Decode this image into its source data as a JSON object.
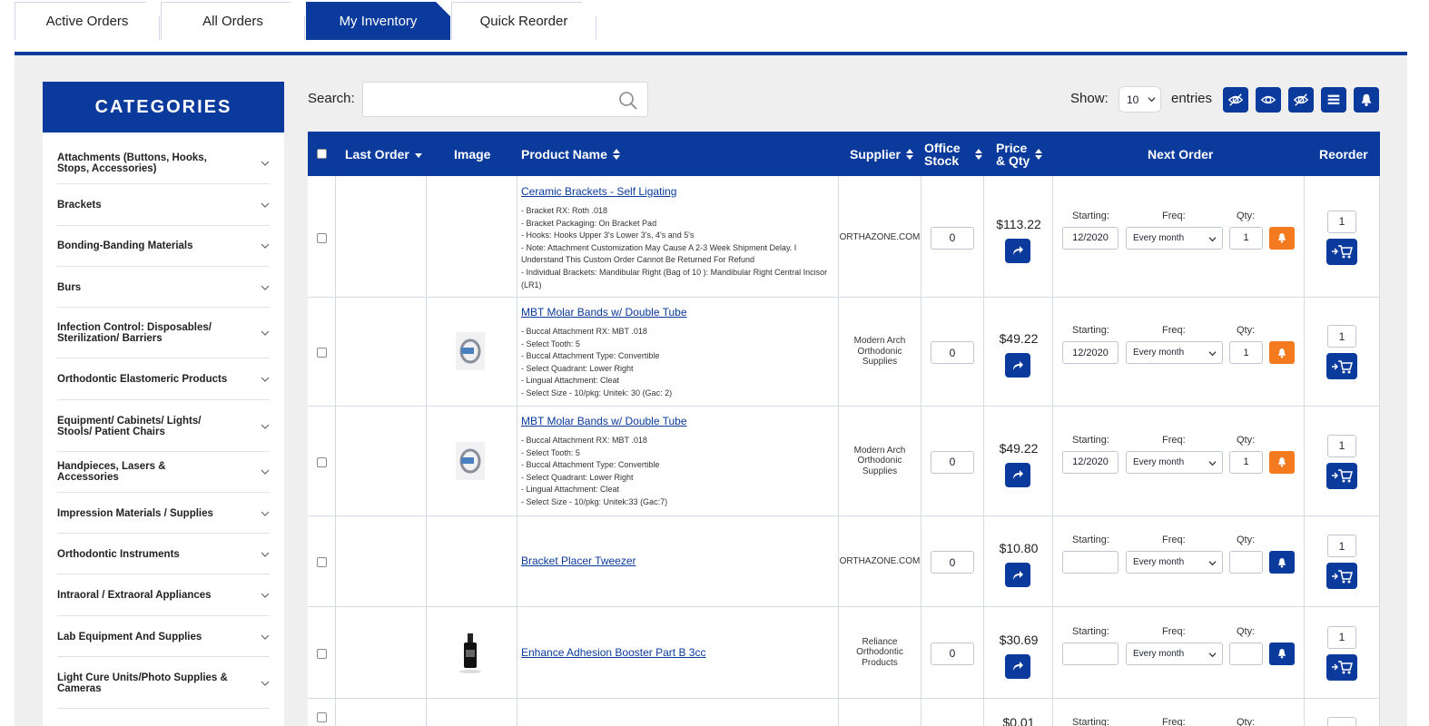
{
  "tabs": [
    {
      "label": "Active Orders"
    },
    {
      "label": "All Orders"
    },
    {
      "label": "My Inventory"
    },
    {
      "label": "Quick Reorder"
    }
  ],
  "categories": {
    "title": "CATEGORIES",
    "items": [
      {
        "label": "Attachments (Buttons, Hooks, Stops, Accessories)"
      },
      {
        "label": "Brackets"
      },
      {
        "label": "Bonding-Banding Materials"
      },
      {
        "label": "Burs"
      },
      {
        "label": "Infection Control: Disposables/ Sterilization/ Barriers"
      },
      {
        "label": "Orthodontic Elastomeric Products"
      },
      {
        "label": "Equipment/ Cabinets/ Lights/ Stools/ Patient Chairs"
      },
      {
        "label": "Handpieces, Lasers & Accessories"
      },
      {
        "label": "Impression Materials / Supplies"
      },
      {
        "label": "Orthodontic Instruments"
      },
      {
        "label": "Intraoral / Extraoral Appliances"
      },
      {
        "label": "Lab Equipment And Supplies"
      },
      {
        "label": "Light Cure Units/Photo Supplies & Cameras"
      }
    ]
  },
  "toolbar": {
    "search_label": "Search:",
    "search_value": "",
    "show_label": "Show:",
    "show_value": "10",
    "entries_label": "entries"
  },
  "table": {
    "headers": {
      "last_order": "Last Order",
      "image": "Image",
      "product_name": "Product Name",
      "supplier": "Supplier",
      "office_stock_1": "Office",
      "office_stock_2": "Stock",
      "price_1": "Price",
      "price_2": "& Qty",
      "next_order": "Next Order",
      "reorder": "Reorder"
    },
    "labels": {
      "starting": "Starting:",
      "freq": "Freq:",
      "qty": "Qty:"
    },
    "rows": [
      {
        "name": "Ceramic Brackets - Self Ligating",
        "desc": [
          "- Bracket RX: Roth .018",
          "- Bracket Packaging: On Bracket Pad",
          "- Hooks: Hooks Upper 3's Lower 3's, 4's and 5's",
          "- Note: Attachment Customization May Cause A 2-3 Week Shipment Delay. I Understand This Custom Order Cannot Be Returned For Refund",
          "- Individual Brackets: Mandibular Right (Bag of 10 ): Mandibular Right Central Incisor (LR1)"
        ],
        "supplier": "ORTHAZONE.COM",
        "stock": "0",
        "price": "$113.22",
        "starting": "12/2020",
        "freq": "Every month",
        "qty": "1",
        "reorder_qty": "1",
        "bell_color": "#f47a20",
        "image": ""
      },
      {
        "name": "MBT Molar Bands w/ Double Tube",
        "desc": [
          "- Buccal Attachment RX: MBT .018",
          "- Select Tooth: 5",
          "- Buccal Attachment Type: Convertible",
          "- Select Quadrant: Lower Right",
          "- Lingual Attachment: Cleat",
          "- Select Size - 10/pkg: Unitek: 30 (Gac: 2)"
        ],
        "supplier": "Modern Arch Orthodonic Supplies",
        "stock": "0",
        "price": "$49.22",
        "starting": "12/2020",
        "freq": "Every month",
        "qty": "1",
        "reorder_qty": "1",
        "bell_color": "#f47a20",
        "image": "band"
      },
      {
        "name": "MBT Molar Bands w/ Double Tube",
        "desc": [
          "- Buccal Attachment RX: MBT .018",
          "- Select Tooth: 5",
          "- Buccal Attachment Type: Convertible",
          "- Select Quadrant: Lower Right",
          "- Lingual Attachment: Cleat",
          "- Select Size - 10/pkg: Unitek:33 (Gac:7)"
        ],
        "supplier": "Modern Arch Orthodonic Supplies",
        "stock": "0",
        "price": "$49.22",
        "starting": "12/2020",
        "freq": "Every month",
        "qty": "1",
        "reorder_qty": "1",
        "bell_color": "#f47a20",
        "image": "band"
      },
      {
        "name": "Bracket Placer Tweezer",
        "desc": [],
        "supplier": "ORTHAZONE.COM",
        "stock": "0",
        "price": "$10.80",
        "starting": "",
        "freq": "Every month",
        "qty": "",
        "reorder_qty": "1",
        "bell_color": "#0a3a9c",
        "image": ""
      },
      {
        "name": "Enhance Adhesion Booster Part B 3cc",
        "desc": [],
        "supplier": "Reliance Orthodontic Products",
        "stock": "0",
        "price": "$30.69",
        "starting": "",
        "freq": "Every month",
        "qty": "",
        "reorder_qty": "1",
        "bell_color": "#0a3a9c",
        "image": "bottle"
      },
      {
        "name": "",
        "desc": [],
        "supplier": "",
        "stock": "",
        "price": "$0.01",
        "starting": "",
        "freq": "",
        "qty": "",
        "reorder_qty": "",
        "bell_color": "#0a3a9c",
        "image": ""
      }
    ]
  }
}
